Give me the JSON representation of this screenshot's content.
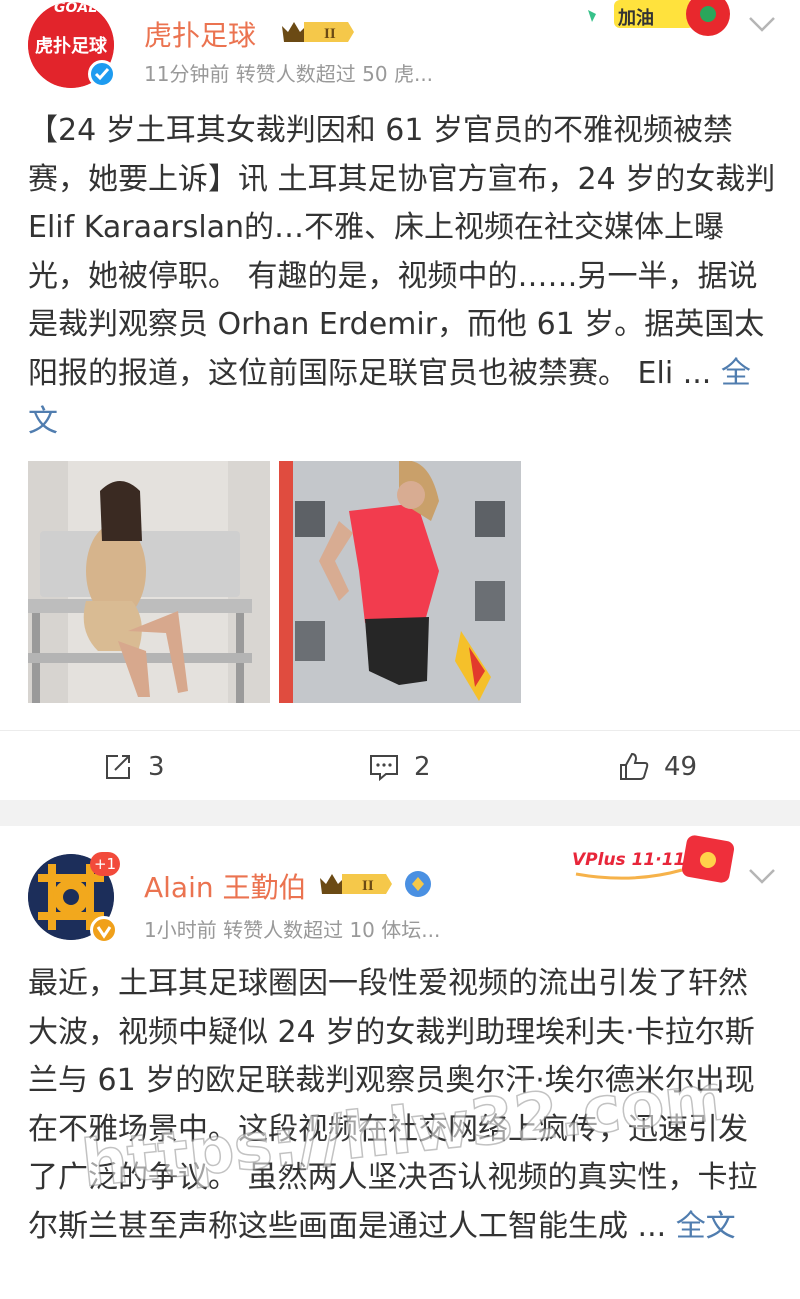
{
  "post1": {
    "author": "虎扑足球",
    "level_badge": "II",
    "meta": "11分钟前  转赞人数超过 50   虎...",
    "avatar_text": "虎扑足球",
    "avatar_goal_text": "GOAL!",
    "sticker_text": "加油",
    "text": "【24 岁土耳其女裁判因和 61 岁官员的不雅视频被禁赛，她要上诉】讯 土耳其足协官方宣布，24 岁的女裁判 Elif Karaarslan的…不雅、床上视频在社交媒体上曝光，她被停职。 有趣的是，视频中的……另一半，据说是裁判观察员 Orhan Erdemir，而他 61 岁。据英国太阳报的报道，这位前国际足联官员也被禁赛。 Eli ... ",
    "full_link": "全文",
    "actions": {
      "repost": "3",
      "comment": "2",
      "like": "49"
    }
  },
  "post2": {
    "author": "Alain 王勤伯",
    "level_badge": "II",
    "meta": "1小时前  转赞人数超过 10   体坛...",
    "avatar_plus": "+1",
    "vplus_text": "VPlus 11·11",
    "text": "最近，土耳其足球圈因一段性爱视频的流出引发了轩然大波，视频中疑似 24 岁的女裁判助理埃利夫·卡拉尔斯兰与 61 岁的欧足联裁判观察员奥尔汗·埃尔德米尔出现在不雅场景中。这段视频在社交网络上疯传，迅速引发了广泛的争议。 虽然两人坚决否认视频的真实性，卡拉尔斯兰甚至声称这些画面是通过人工智能生成 ... ",
    "full_link": "全文"
  },
  "watermark": "https://hlw32.com  黑料网",
  "colors": {
    "name": "#eb7350",
    "link": "#507daf",
    "meta": "#999999"
  }
}
